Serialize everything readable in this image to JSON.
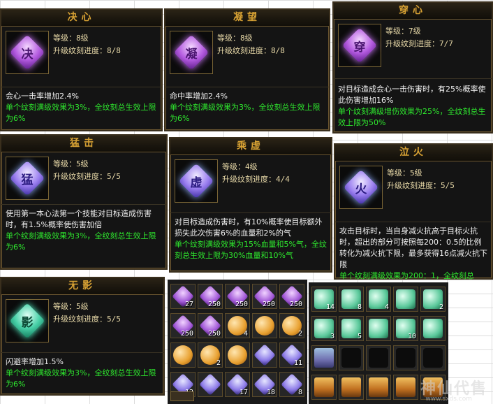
{
  "labels": {
    "level": "等级：",
    "progress": "升级纹刻进度："
  },
  "cards": [
    {
      "title": "决心",
      "glyph": "决",
      "color": "purple",
      "level": "8级",
      "progress": "8/8",
      "desc": "会心一击率增加2.4%",
      "green": "单个纹刻满级效果为3%，全纹刻总生效上限为6%"
    },
    {
      "title": "凝望",
      "glyph": "凝",
      "color": "purple",
      "level": "8级",
      "progress": "8/8",
      "desc": "命中率增加2.4%",
      "green": "单个纹刻满级效果为3%，全纹刻总生效上限为6%"
    },
    {
      "title": "穿心",
      "glyph": "穿",
      "color": "purple",
      "level": "7级",
      "progress": "7/7",
      "desc": "对目标造成会心一击伤害时，有25%概率使此伤害增加16%",
      "green": "单个纹刻满级增伤效果为25%，全纹刻总生效上限为50%"
    },
    {
      "title": "猛击",
      "glyph": "猛",
      "color": "blue",
      "level": "5级",
      "progress": "5/5",
      "desc": "使用第一本心法第一个技能对目标造成伤害时，有1.5%概率使伤害加倍",
      "green": "单个纹刻满级效果为3%，全纹刻总生效上限为6%"
    },
    {
      "title": "乘虚",
      "glyph": "虚",
      "color": "blue",
      "level": "4级",
      "progress": "4/4",
      "desc": "对目标造成伤害时，有10%概率使目标额外损失此次伤害6%的血量和2%的气",
      "green": "单个纹刻满级效果为15%血量和5%气，全纹刻总生效上限为30%血量和10%气"
    },
    {
      "title": "泣火",
      "glyph": "火",
      "color": "blue",
      "level": "5级",
      "progress": "5/5",
      "desc": "攻击目标时，当自身减火抗高于目标火抗时，超出的部分可按照每200：0.5的比例转化为减火抗下限，最多获得16点减火抗下限",
      "green": "单个纹刻满级效果为200：1，全纹刻总"
    },
    {
      "title": "无影",
      "glyph": "影",
      "color": "green",
      "level": "5级",
      "progress": "5/5",
      "desc": "闪避率增加1.5%",
      "green": "单个纹刻满级效果为3%，全纹刻总生效上限为6%"
    }
  ],
  "inventory_left": [
    {
      "type": "purple",
      "count": "27"
    },
    {
      "type": "purple",
      "count": "250"
    },
    {
      "type": "purple",
      "count": "250"
    },
    {
      "type": "purple",
      "count": "250"
    },
    {
      "type": "purple",
      "count": "250"
    },
    {
      "type": "purple",
      "count": "250"
    },
    {
      "type": "purple",
      "count": "250"
    },
    {
      "type": "orange",
      "count": "4"
    },
    {
      "type": "orange",
      "count": ""
    },
    {
      "type": "orange",
      "count": "2"
    },
    {
      "type": "orange",
      "count": ""
    },
    {
      "type": "orange",
      "count": "2"
    },
    {
      "type": "orange",
      "count": ""
    },
    {
      "type": "blue",
      "count": ""
    },
    {
      "type": "blue",
      "count": "11"
    },
    {
      "type": "blue",
      "count": "12"
    },
    {
      "type": "blue",
      "count": ""
    },
    {
      "type": "blue",
      "count": "17"
    },
    {
      "type": "blue",
      "count": "18"
    },
    {
      "type": "blue",
      "count": "8"
    }
  ],
  "inventory_right": [
    {
      "type": "green",
      "count": "14"
    },
    {
      "type": "green",
      "count": "8"
    },
    {
      "type": "green",
      "count": "4"
    },
    {
      "type": "green",
      "count": ""
    },
    {
      "type": "green",
      "count": "2"
    },
    {
      "type": "green",
      "count": "3"
    },
    {
      "type": "green",
      "count": "5"
    },
    {
      "type": "green",
      "count": ""
    },
    {
      "type": "green",
      "count": "10"
    },
    {
      "type": "green",
      "count": ""
    },
    {
      "type": "chest2",
      "count": ""
    },
    {
      "type": "empty",
      "count": ""
    },
    {
      "type": "empty",
      "count": ""
    },
    {
      "type": "empty",
      "count": ""
    },
    {
      "type": "empty",
      "count": ""
    },
    {
      "type": "chest",
      "count": ""
    },
    {
      "type": "chest",
      "count": ""
    },
    {
      "type": "chest",
      "count": ""
    },
    {
      "type": "chest",
      "count": ""
    },
    {
      "type": "chest",
      "count": ""
    }
  ],
  "watermark": {
    "text": "神仙代售",
    "url": "www.sxds.com"
  }
}
